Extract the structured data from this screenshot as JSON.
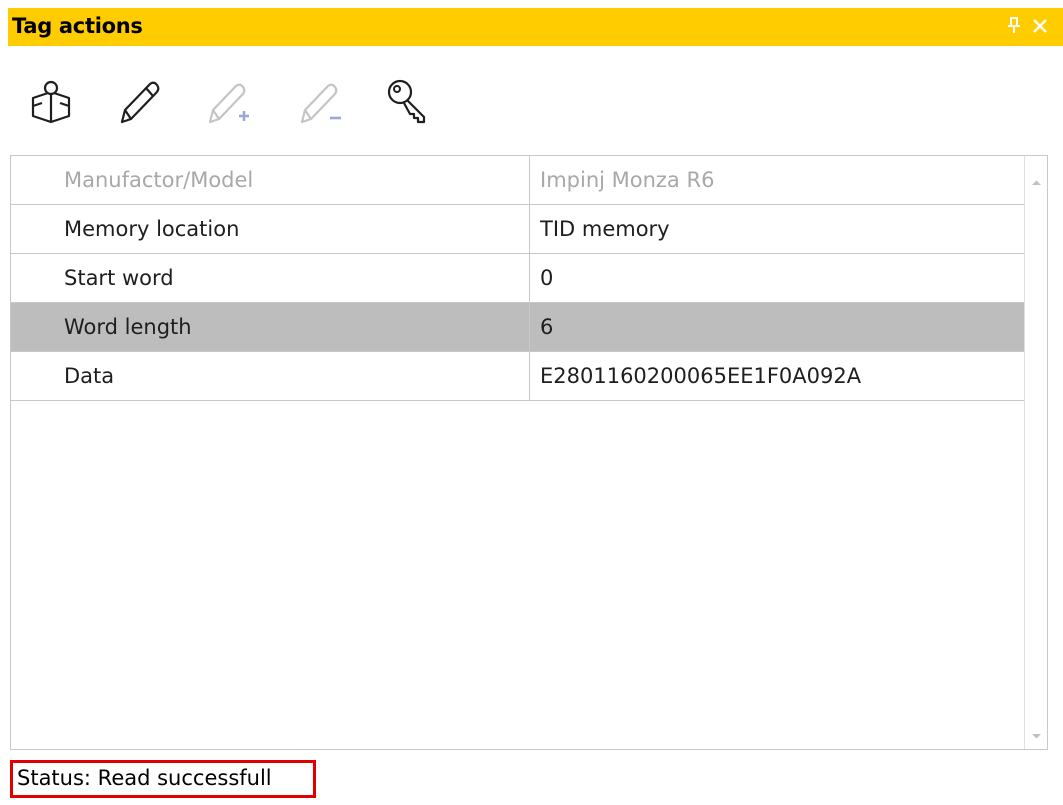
{
  "window": {
    "title": "Tag actions",
    "accent_color": "#ffcc00"
  },
  "toolbar": {
    "buttons": [
      {
        "name": "inventory-icon",
        "enabled": true
      },
      {
        "name": "pencil-icon",
        "enabled": true
      },
      {
        "name": "pencil-add-icon",
        "enabled": false
      },
      {
        "name": "pencil-remove-icon",
        "enabled": false
      },
      {
        "name": "key-icon",
        "enabled": true
      }
    ]
  },
  "grid": {
    "rows": [
      {
        "name": "Manufactor/Model",
        "value": "Impinj Monza R6",
        "state": "disabled"
      },
      {
        "name": "Memory location",
        "value": "TID memory",
        "state": "normal"
      },
      {
        "name": "Start word",
        "value": "0",
        "state": "normal"
      },
      {
        "name": "Word length",
        "value": "6",
        "state": "selected"
      },
      {
        "name": "Data",
        "value": "E2801160200065EE1F0A092A",
        "state": "normal"
      }
    ],
    "selected_row_color": "#bdbdbd"
  },
  "status": {
    "text": "Status: Read successfull",
    "highlight_color": "#e00000"
  }
}
